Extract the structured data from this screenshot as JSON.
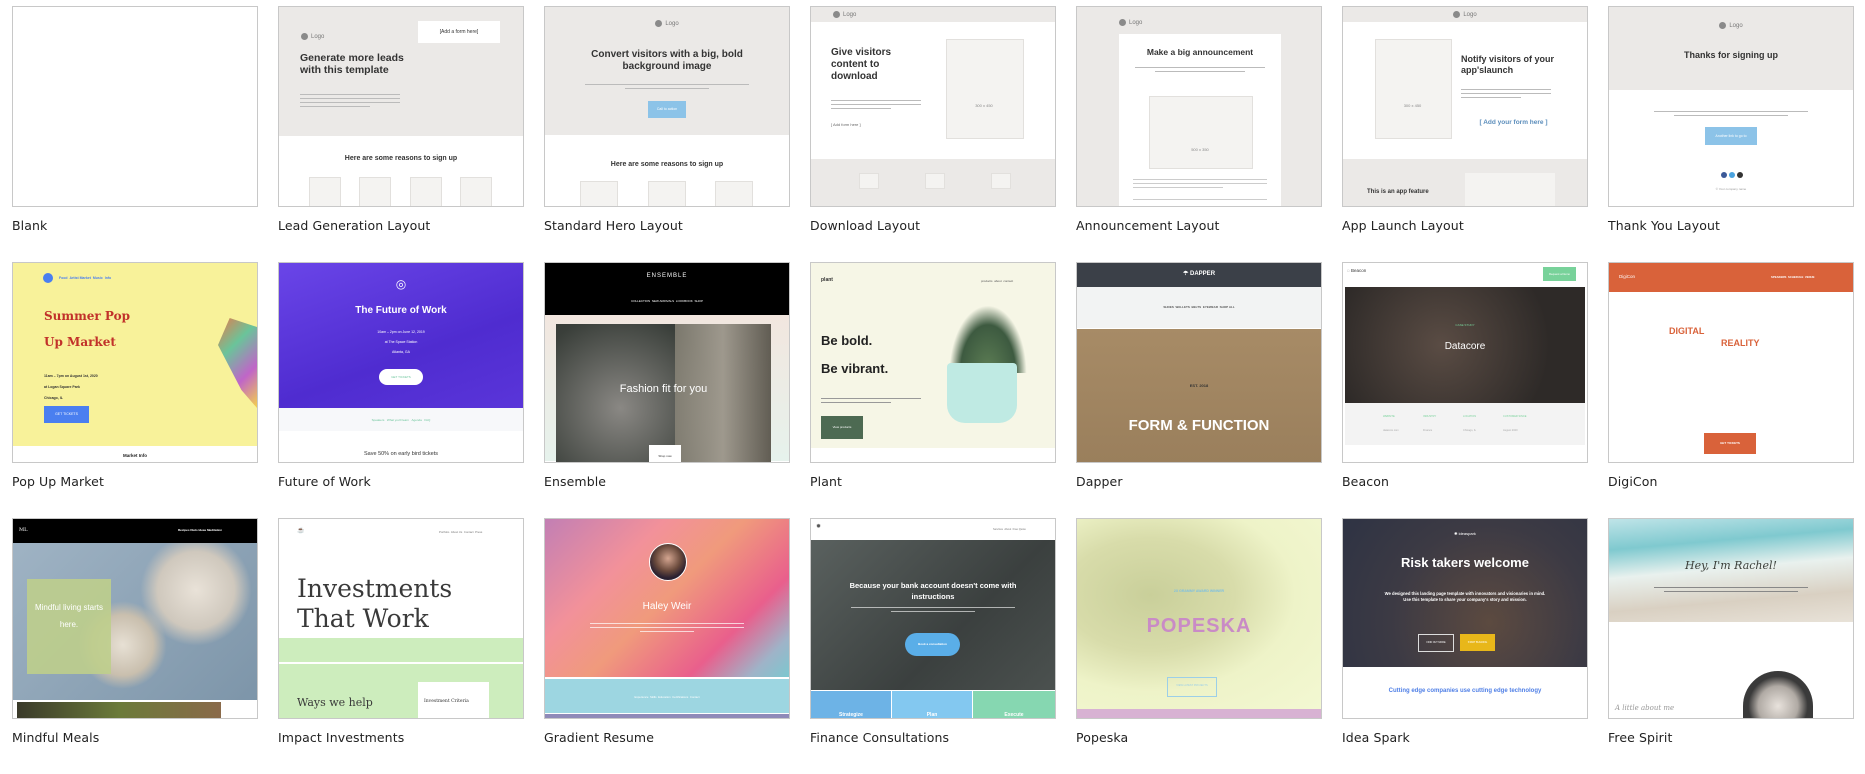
{
  "templates": [
    {
      "name": "Blank"
    },
    {
      "name": "Lead Generation Layout",
      "logo": "Logo",
      "headline": "Generate more leads with this template",
      "form_text": "[Add a form here]",
      "section_title": "Here are some reasons to sign up"
    },
    {
      "name": "Standard Hero Layout",
      "logo": "Logo",
      "headline": "Convert visitors with a big, bold background image",
      "cta": "Call to action",
      "section_title": "Here are some reasons to sign up"
    },
    {
      "name": "Download Layout",
      "logo": "Logo",
      "headline": "Give visitors content to download",
      "form_text": "[ Add form here ]",
      "image_size": "300 x 450"
    },
    {
      "name": "Announcement Layout",
      "logo": "Logo",
      "headline": "Make a big announcement",
      "image_size": "500 x 350"
    },
    {
      "name": "App Launch Layout",
      "logo": "Logo",
      "headline": "Notify visitors of your app'slaunch",
      "form_text": "[ Add your form here ]",
      "feature": "This is an app feature",
      "image_size": "300 x 450"
    },
    {
      "name": "Thank You Layout",
      "logo": "Logo",
      "headline": "Thanks for signing up",
      "cta": "Another link to go to",
      "footer": "© Your company name"
    },
    {
      "name": "Pop Up Market",
      "nav": [
        "Food",
        "Artist Market",
        "Music",
        "Info"
      ],
      "headline1": "Summer Pop",
      "headline2": "Up Market",
      "details": [
        "11am – 7pm on August 1st, 2020",
        "at Logan Square Park",
        "Chicago, IL"
      ],
      "cta": "GET TICKETS",
      "footer_title": "Market Info"
    },
    {
      "name": "Future of Work",
      "headline": "The Future of Work",
      "details": [
        "10am – 2pm on June 12, 2019",
        "at The Space Station",
        "Atlanta, GA"
      ],
      "cta": "GET TICKETS",
      "nav": [
        "Speakers",
        "What you'll learn",
        "Agenda",
        "FAQ"
      ],
      "footer_title": "Save 50% on early bird tickets"
    },
    {
      "name": "Ensemble",
      "brand": "ENSEMBLE",
      "nav": [
        "COLLECTION",
        "NEW ARRIVALS",
        "LOOKBOOK",
        "SHOP"
      ],
      "headline": "Fashion fit for you",
      "cta": "Shop now"
    },
    {
      "name": "Plant",
      "brand": "plant",
      "nav": [
        "products",
        "about",
        "contact"
      ],
      "headline1": "Be bold.",
      "headline2": "Be vibrant.",
      "cta": "View products"
    },
    {
      "name": "Dapper",
      "brand": "DAPPER",
      "nav": [
        "SHOES",
        "WALLETS",
        "BELTS",
        "EYEWEAR",
        "SHOP ALL"
      ],
      "tag": "EST. 2018",
      "headline": "FORM & FUNCTION"
    },
    {
      "name": "Beacon",
      "brand": "Beacon",
      "cta": "Request a Demo",
      "kicker": "CASE STUDY",
      "headline": "Datacore",
      "facts": [
        "WEBSITE",
        "INDUSTRY",
        "LOCATION",
        "CUSTOMER SINCE"
      ],
      "values": [
        "datacore.com",
        "Finance",
        "Chicago, IL",
        "August 2020"
      ]
    },
    {
      "name": "DigiCon",
      "brand": "DigiCon",
      "nav": [
        "SPEAKERS",
        "SCHEDULE",
        "VENUE"
      ],
      "headline1": "DIGITAL",
      "headline2": "REALITY",
      "cta": "GET TICKETS"
    },
    {
      "name": "Mindful Meals",
      "brand": "ML",
      "nav": [
        "Recipes",
        "Diets",
        "Ideas",
        "Meditation"
      ],
      "headline": "Mindful living starts here."
    },
    {
      "name": "Impact Investments",
      "nav": [
        "Portfolio",
        "About Us",
        "Contact",
        "Press"
      ],
      "headline": "Investments That Work",
      "subhead": "Ways we help",
      "box": "Investment Criteria"
    },
    {
      "name": "Gradient Resume",
      "headline": "Haley Weir",
      "nav": [
        "Experience",
        "Skills",
        "Education",
        "Certifications",
        "Contact"
      ]
    },
    {
      "name": "Finance Consultations",
      "nav": [
        "Services",
        "About",
        "Free Quote"
      ],
      "headline": "Because your bank account doesn't come with instructions",
      "cta": "Book a consultation",
      "tiles": [
        "Strategize",
        "Plan",
        "Execute"
      ]
    },
    {
      "name": "Popeska",
      "kicker": "2X GRAMMY AWARD WINNER",
      "headline": "POPESKA",
      "cta": "VIEW LATEST PROJECTS"
    },
    {
      "name": "Idea Spark",
      "brand": "ideaspark",
      "headline": "Risk takers welcome",
      "body": "We designed this landing page template with innovators and visionaries in mind. Use this template to share your company's story and mission.",
      "cta1": "FIND OUT MORE",
      "cta2": "START BUILDING",
      "subhead": "Cutting edge companies use cutting edge technology"
    },
    {
      "name": "Free Spirit",
      "headline": "Hey, I'm Rachel!",
      "subhead": "A little about me"
    }
  ],
  "colors": {
    "wireframe_bg": "#ebe9e7",
    "popup_yellow": "#f8f29a",
    "popup_red": "#c1312a",
    "future_purple": "#5a35d9",
    "digicon_orange": "#d9623a",
    "plant_bg": "#f6f6e6",
    "plant_green": "#4d6a52",
    "dapper_dark": "#3b4048",
    "dapper_tan": "#a78b66",
    "beacon_green": "#78d29a",
    "impact_green": "#cdedbd",
    "finance_blue": "#5aaee8",
    "popeska_pink": "#c98bc6",
    "ideaspark_yellow": "#e8b71a",
    "ideaspark_blue": "#4f7fe6",
    "cta_blue": "#8cc3e8"
  }
}
